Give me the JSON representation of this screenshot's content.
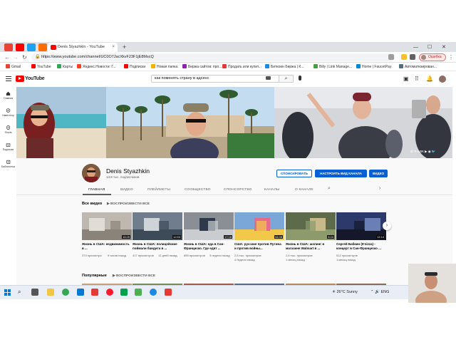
{
  "browser": {
    "active_tab_title": "Denis Styazhkin - YouTube",
    "tab_close": "×",
    "new_tab": "+",
    "window_controls": [
      "—",
      "☐",
      "✕"
    ],
    "url": "https://www.youtube.com/channel/UC0O7JacXkvF23F1jE8MscQ",
    "profile_label": "Ошибка",
    "nav": {
      "back": "←",
      "forward": "→",
      "reload": "↻"
    }
  },
  "bookmarks": [
    {
      "label": "Gmail",
      "color": "#ea4335"
    },
    {
      "label": "YouTube",
      "color": "#ff0000"
    },
    {
      "label": "Карты",
      "color": "#34a853"
    },
    {
      "label": "Яндекс.Новости: Г...",
      "color": "#fc3f1d"
    },
    {
      "label": "Подписки",
      "color": "#ff0000"
    },
    {
      "label": "Новая папка",
      "color": "#f4b400"
    },
    {
      "label": "Биржа сайтов: про...",
      "color": "#8e24aa"
    },
    {
      "label": "Продать или купит...",
      "color": "#e53935"
    },
    {
      "label": "Биткоин Биржа | К...",
      "color": "#1e88e5"
    },
    {
      "label": "Billy | Link Manage...",
      "color": "#43a047"
    },
    {
      "label": "Home | FaucetPay",
      "color": "#0288d1"
    },
    {
      "label": "Автоматизирован...",
      "color": "#546e7a"
    }
  ],
  "youtube": {
    "logo_text": "YouTube",
    "search_value": "как поменять страну в адсенс",
    "search_button": "⌕",
    "guide": [
      {
        "label": "Главная"
      },
      {
        "label": "Навигатор"
      },
      {
        "label": "Shorts"
      },
      {
        "label": "Подписки"
      },
      {
        "label": "Библиотека"
      }
    ]
  },
  "banner": {
    "links": "⊞ Я в ВК   ▶  ◉  🐦"
  },
  "channel": {
    "name": "Denis Styazhkin",
    "subscribers": "13,8 тыс. подписчиков",
    "btn_donate": "СПОНСИРОВАТЬ",
    "btn_customize": "НАСТРОИТЬ ВИД КАНАЛА",
    "btn_video": "ВИДЕО",
    "tabs": [
      "ГЛАВНАЯ",
      "ВИДЕО",
      "ПЛЕЙЛИСТЫ",
      "СООБЩЕСТВО",
      "СПОНСОРСТВО",
      "КАНАЛЫ",
      "О КАНАЛЕ"
    ],
    "search_icon": "⌕",
    "more_icon": "›"
  },
  "sections": {
    "all_videos": "Все видео",
    "play_all": "ВОСПРОИЗВЕСТИ ВСЕ",
    "popular": "Популярные",
    "play_all_2": "ВОСПРОИЗВЕСТИ ВСЕ"
  },
  "videos": [
    {
      "title": "Жизнь в США: недвижимость в ...",
      "duration": "15:25",
      "views": "374 просмотра",
      "age": "9 часов назад"
    },
    {
      "title": "Жизнь в США: полицейские поймали бандита в ...",
      "duration": "12:53",
      "views": "417 просмотров",
      "age": "12 дней назад"
    },
    {
      "title": "Жизнь в США: еда в Сан-Франциско. Где едят ...",
      "duration": "17:18",
      "views": "855 просмотров",
      "age": "3 недели назад"
    },
    {
      "title": "США: русские против Путина и против войны...",
      "duration": "34:06",
      "views": "2,5 тыс. просмотров",
      "age": "4 недели назад"
    },
    {
      "title": "Жизнь в США: шопинг в магазине Walmart в ...",
      "duration": "5:24",
      "views": "2,6 тыс. просмотров",
      "age": "1 месяц назад"
    },
    {
      "title": "Сергей Бабкин (5'nizza) - концерт в Сан-Франциско ...",
      "duration": "12:14",
      "views": "512 просмотров",
      "age": "1 месяц назад"
    }
  ],
  "carousel_next": "›",
  "taskbar": {
    "weather": "26°C  Sunny",
    "tray": "⌃  🔊  ENG",
    "start_icon": "windows-icon"
  }
}
